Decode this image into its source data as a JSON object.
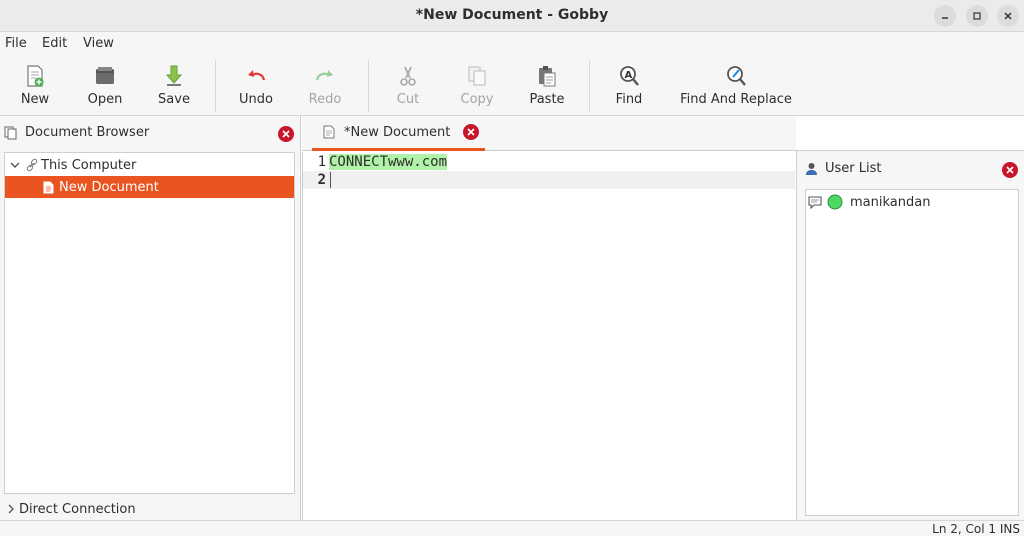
{
  "window": {
    "title": "*New Document - Gobby"
  },
  "menu": [
    "File",
    "Edit",
    "View"
  ],
  "toolbar": {
    "new": "New",
    "open": "Open",
    "save": "Save",
    "undo": "Undo",
    "redo": "Redo",
    "cut": "Cut",
    "copy": "Copy",
    "paste": "Paste",
    "find": "Find",
    "find_replace": "Find And Replace"
  },
  "document_browser": {
    "title": "Document Browser",
    "root": "This Computer",
    "items": [
      "New Document"
    ],
    "direct_connection": "Direct Connection"
  },
  "editor": {
    "tab_label": "*New Document",
    "lines": [
      {
        "number": "1",
        "text": "CONNECTwww.com"
      },
      {
        "number": "2",
        "text": ""
      }
    ]
  },
  "user_list": {
    "title": "User List",
    "users": [
      "manikandan"
    ]
  },
  "status": "Ln 2, Col 1  INS",
  "colors": {
    "accent": "#e95420",
    "close": "#c7162b",
    "user_online": "#4cd964",
    "text_highlight": "#b0f2a8"
  }
}
